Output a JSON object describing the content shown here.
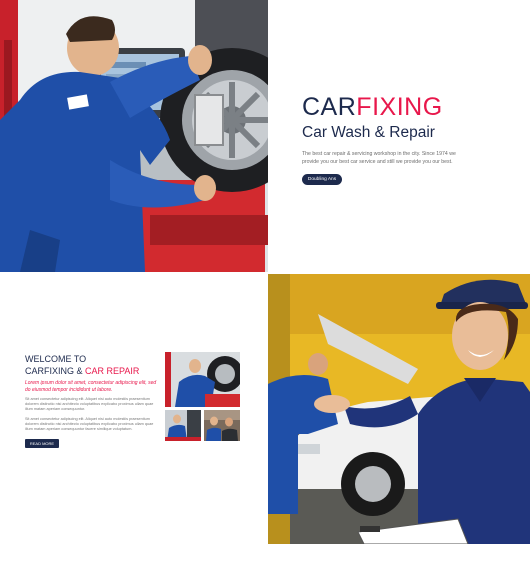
{
  "hero": {
    "brand_part1": "CAR",
    "brand_part2": "FIXING",
    "subtitle": "Car Wash & Repair",
    "description": "The best car repair & servicing workshop in the city. Since 1974 we provide you our best car service and still we provide you our best.",
    "button_label": "Doubling Ans"
  },
  "welcome": {
    "title_line1": "WELCOME TO",
    "title_line2_part1": "CARFIXING & ",
    "title_line2_part2": "CAR REPAIR",
    "lead": "Lorem ipsum dolor sit amet, consectetur adipiscing elit, sed do eiusmod tempor incididunt ut labore.",
    "paragraph1": "Sit amet consectetur adipiscing elit. Aliquet nisi auto molestiis praesentium dolorem distinctio nisi architecto voluptatibus explicabo proximus ullam quae illum matam aperiam consequuntur.",
    "paragraph2": "Sit amet consectetur adipiscing elit. Aliquet nisi auto molestiis praesentium dolorem distinctio nisi architecto voluptatibus explicabo proximus ullam quae illum matam aperiam consequuntur facere similique voluptatum.",
    "button_label": "READ MORE"
  },
  "colors": {
    "navy": "#1d2a4d",
    "accent_red": "#e8174b",
    "uniform_blue": "#1f4fa8",
    "garage_yellow": "#e8b825"
  }
}
